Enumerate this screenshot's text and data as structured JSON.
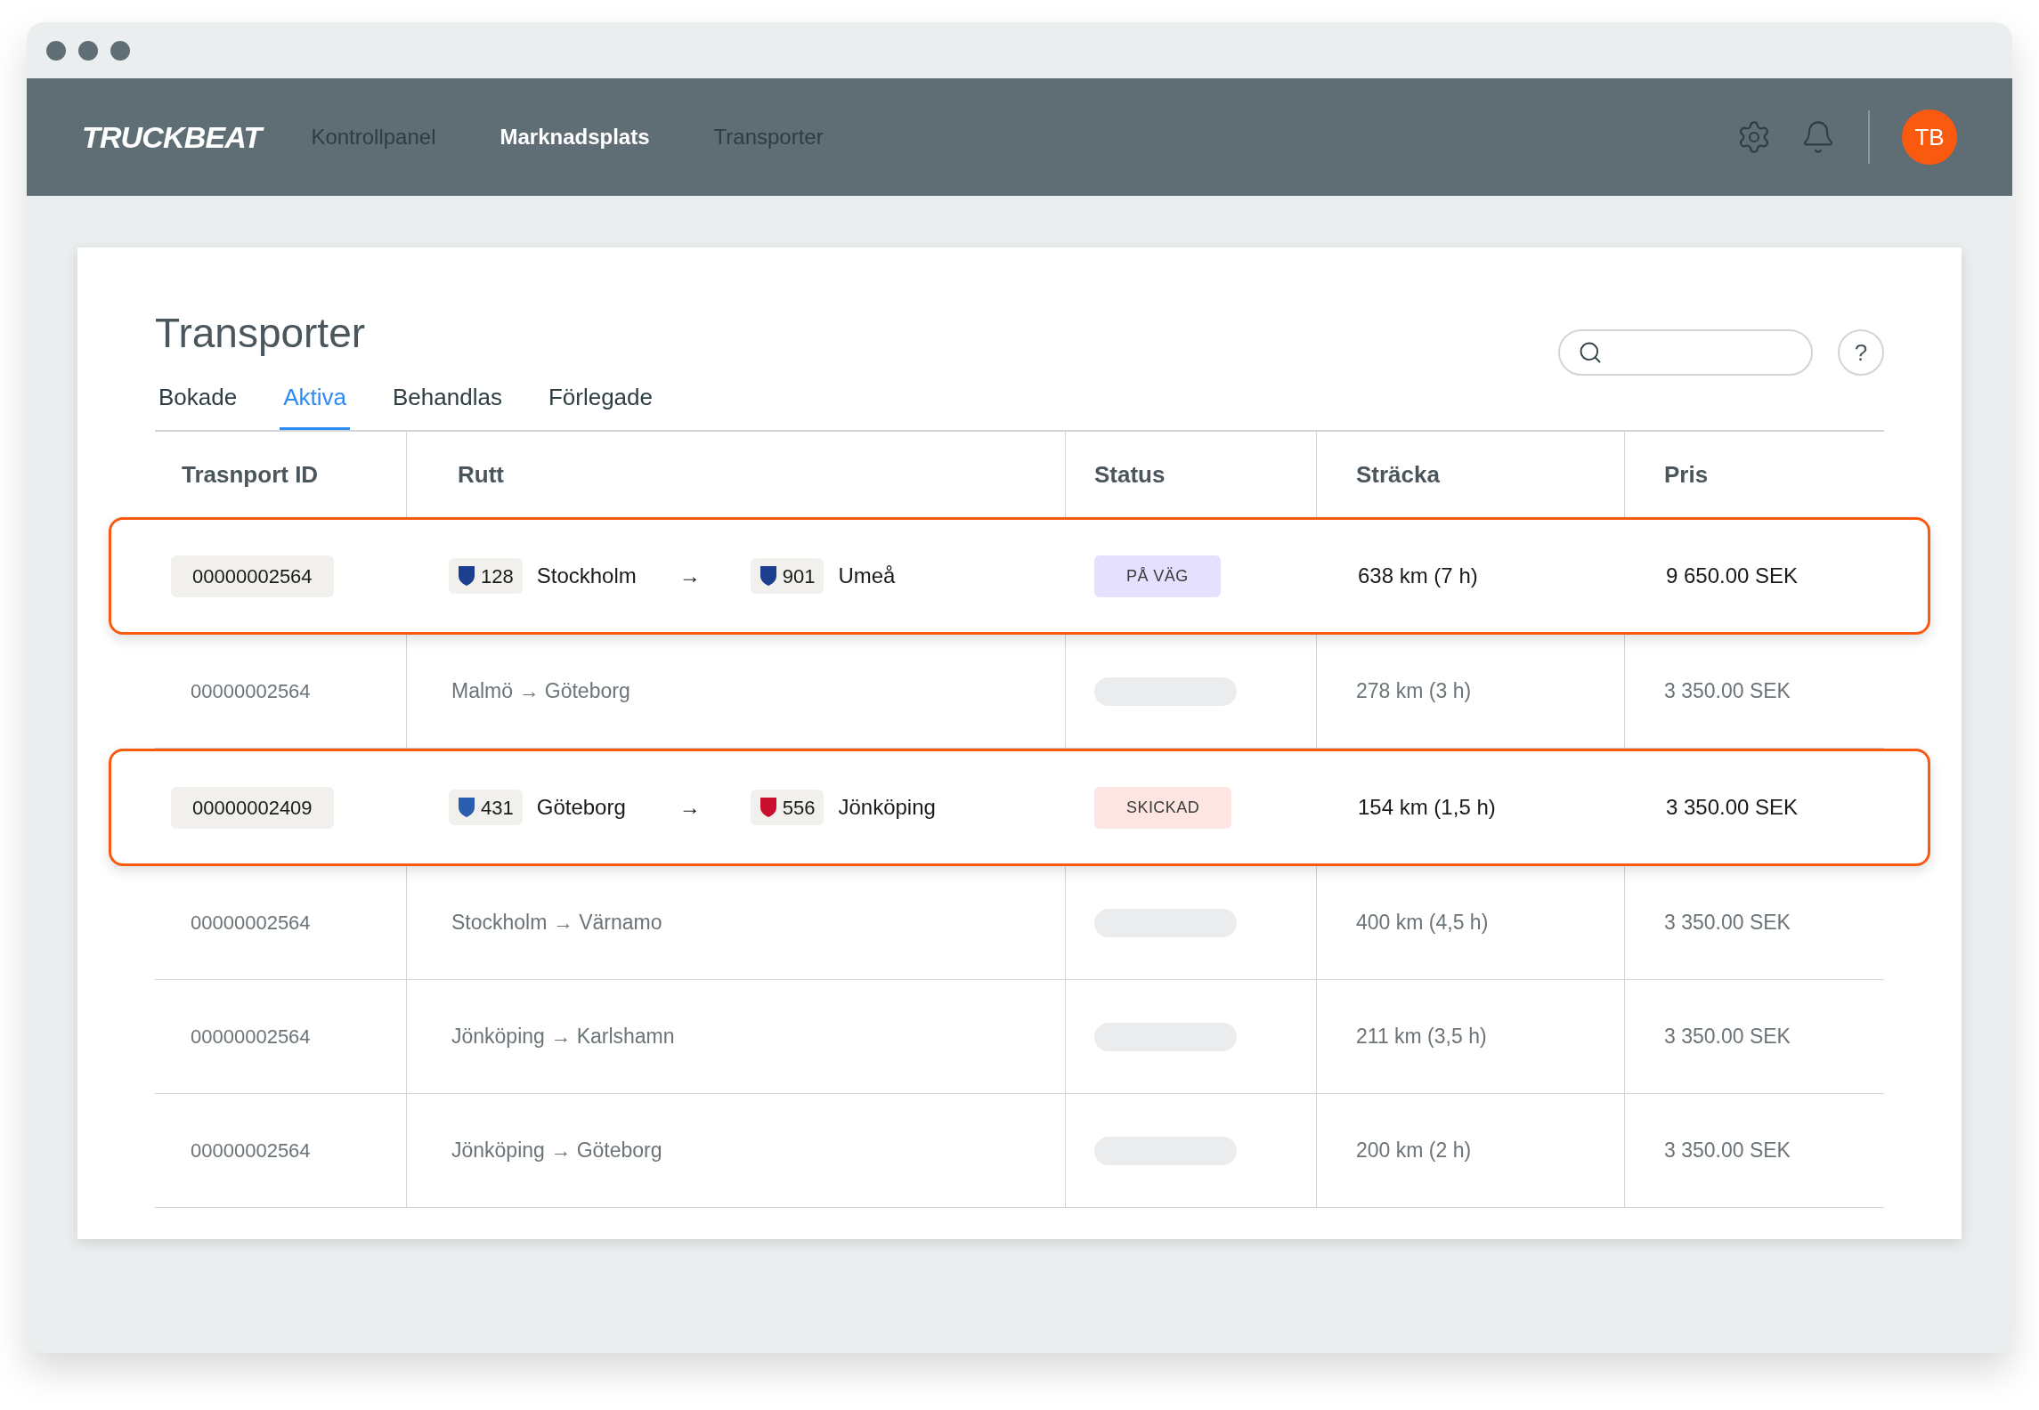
{
  "brand": "TRUCKBEAT",
  "nav": [
    {
      "label": "Kontrollpanel",
      "selected": false
    },
    {
      "label": "Marknadsplats",
      "selected": true
    },
    {
      "label": "Transporter",
      "selected": false
    }
  ],
  "user": {
    "initials": "TB"
  },
  "page": {
    "title": "Transporter",
    "help": "?"
  },
  "tabs": [
    {
      "label": "Bokade",
      "selected": false
    },
    {
      "label": "Aktiva",
      "selected": true
    },
    {
      "label": "Behandlas",
      "selected": false
    },
    {
      "label": "Förlegade",
      "selected": false
    }
  ],
  "table": {
    "columns": [
      "Trasnport ID",
      "Rutt",
      "Status",
      "Sträcka",
      "Pris"
    ],
    "rows": [
      {
        "kind": "highlighted",
        "id": "00000002564",
        "from": {
          "code": "128",
          "city": "Stockholm",
          "color": "#1d3f8f"
        },
        "arrow": "→",
        "to": {
          "code": "901",
          "city": "Umeå",
          "color": "#1d3f8f"
        },
        "status": {
          "label": "PÅ VÄG",
          "color": "#e4e0fd"
        },
        "distance": "638 km (7 h)",
        "price": "9 650.00 SEK"
      },
      {
        "kind": "muted",
        "id": "00000002564",
        "route": "Malmö → Göteborg",
        "distance": "278 km (3 h)",
        "price": "3 350.00 SEK"
      },
      {
        "kind": "highlighted",
        "id": "00000002409",
        "from": {
          "code": "431",
          "city": "Göteborg",
          "color": "#2a5db0"
        },
        "arrow": "→",
        "to": {
          "code": "556",
          "city": "Jönköping",
          "color": "#c8102e"
        },
        "status": {
          "label": "SKICKAD",
          "color": "#fde6e1"
        },
        "distance": "154 km (1,5 h)",
        "price": "3 350.00 SEK"
      },
      {
        "kind": "muted",
        "id": "00000002564",
        "route": "Stockholm → Värnamo",
        "distance": "400 km (4,5 h)",
        "price": "3 350.00 SEK"
      },
      {
        "kind": "muted",
        "id": "00000002564",
        "route": "Jönköping → Karlshamn",
        "distance": "211 km (3,5 h)",
        "price": "3 350.00 SEK"
      },
      {
        "kind": "muted",
        "id": "00000002564",
        "route": "Jönköping → Göteborg",
        "distance": "200 km (2 h)",
        "price": "3 350.00 SEK"
      }
    ]
  }
}
